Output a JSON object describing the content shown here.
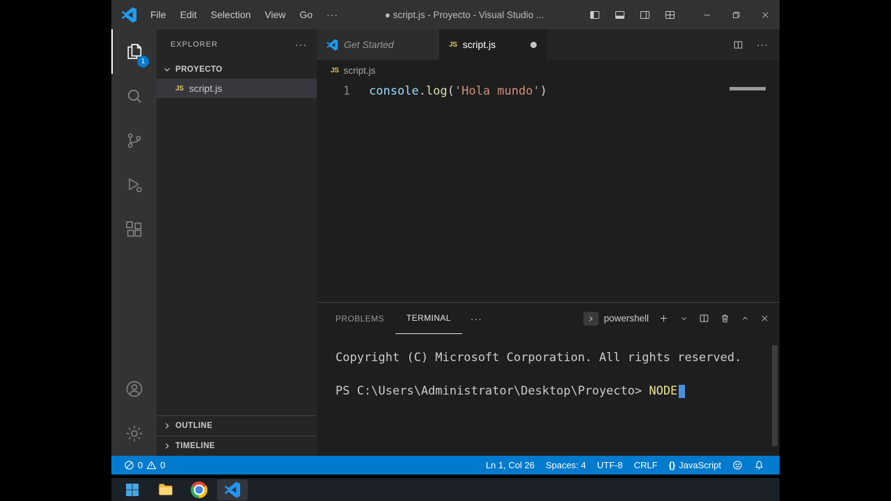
{
  "titlebar": {
    "menus": [
      "File",
      "Edit",
      "Selection",
      "View",
      "Go"
    ],
    "more_menu": "···",
    "title": "● script.js - Proyecto - Visual Studio ..."
  },
  "activitybar": {
    "explorer_badge": "1"
  },
  "icons": {
    "js_badge": "JS"
  },
  "sidebar": {
    "header": "EXPLORER",
    "more": "···",
    "project": "PROYECTO",
    "file": "script.js",
    "outline": "OUTLINE",
    "timeline": "TIMELINE"
  },
  "editor": {
    "tabs": [
      {
        "label": "Get Started"
      },
      {
        "label": "script.js"
      }
    ],
    "tab_actions_more": "···",
    "breadcrumb_file": "script.js",
    "line_number": "1",
    "code": {
      "object": "console",
      "dot": ".",
      "method": "log",
      "open_paren": "(",
      "string": "'Hola mundo'",
      "close_paren": ")"
    }
  },
  "panel": {
    "tab_problems": "PROBLEMS",
    "tab_terminal": "TERMINAL",
    "more": "···",
    "shell_name": "powershell",
    "copyright_line": "Copyright (C) Microsoft Corporation. All rights reserved.",
    "prompt": "PS C:\\Users\\Administrator\\Desktop\\Proyecto> ",
    "command": "NODE"
  },
  "statusbar": {
    "errors": "0",
    "warnings": "0",
    "cursor_position": "Ln 1, Col 26",
    "indentation": "Spaces: 4",
    "encoding": "UTF-8",
    "eol": "CRLF",
    "language_braces": "{}",
    "language": "JavaScript"
  },
  "colors": {
    "accent": "#007acc",
    "titlebar_bg": "#323233",
    "editor_bg": "#1e1e1e",
    "sidebar_bg": "#252526",
    "token_object": "#9cdcfe",
    "token_method": "#dcdcaa",
    "token_string": "#ce9178",
    "terminal_command": "#ece58e",
    "terminal_cursor": "#4d90d9",
    "js_icon": "#e0ca58"
  }
}
